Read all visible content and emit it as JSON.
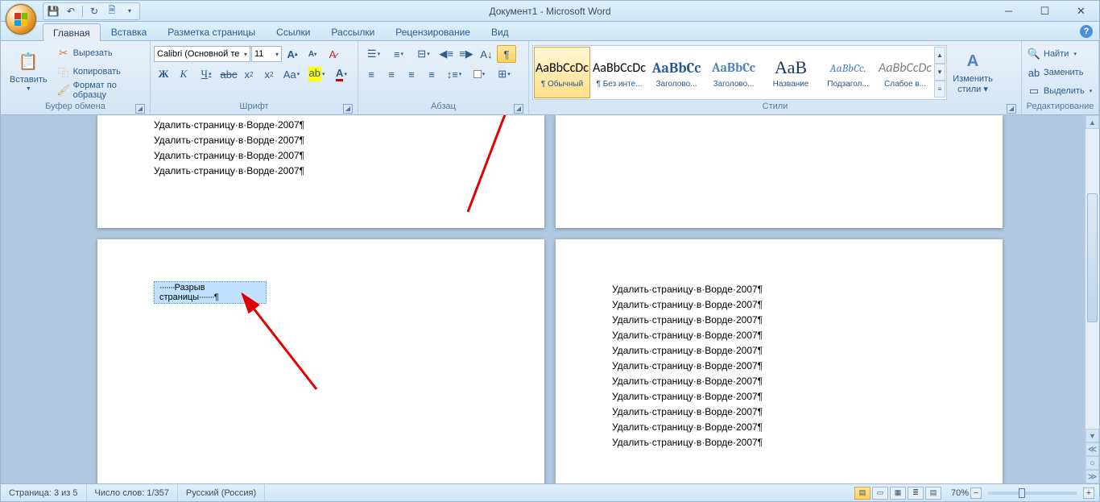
{
  "title": "Документ1 - Microsoft Word",
  "qat_tips": {
    "save": "💾",
    "undo": "↶",
    "redo": "↻",
    "print": "🖨"
  },
  "tabs": [
    "Главная",
    "Вставка",
    "Разметка страницы",
    "Ссылки",
    "Рассылки",
    "Рецензирование",
    "Вид"
  ],
  "clipboard": {
    "paste": "Вставить",
    "cut": "Вырезать",
    "copy": "Копировать",
    "format_painter": "Формат по образцу",
    "group": "Буфер обмена"
  },
  "font": {
    "name": "Calibri (Основной те",
    "size": "11",
    "group": "Шрифт"
  },
  "paragraph": {
    "group": "Абзац"
  },
  "styles": {
    "group": "Стили",
    "items": [
      {
        "preview": "AaBbCcDc",
        "label": "¶ Обычный",
        "sel": true,
        "color": "#000",
        "fam": "Calibri"
      },
      {
        "preview": "AaBbCcDc",
        "label": "¶ Без инте...",
        "color": "#000",
        "fam": "Calibri"
      },
      {
        "preview": "AaBbCc",
        "label": "Заголово...",
        "color": "#2a5a9a",
        "fam": "Cambria",
        "fs": 18,
        "fw": "bold"
      },
      {
        "preview": "AaBbCc",
        "label": "Заголово...",
        "color": "#4f81bd",
        "fam": "Cambria",
        "fs": 16,
        "fw": "bold"
      },
      {
        "preview": "АаВ",
        "label": "Название",
        "color": "#17365d",
        "fam": "Cambria",
        "fs": 22
      },
      {
        "preview": "AaBbCc.",
        "label": "Подзагол...",
        "color": "#4f81bd",
        "fam": "Cambria",
        "fs": 14,
        "fst": "italic"
      },
      {
        "preview": "AaBbCcDc",
        "label": "Слабое в...",
        "color": "#808080",
        "fam": "Calibri",
        "fst": "italic"
      }
    ],
    "change": "Изменить\nстили"
  },
  "editing": {
    "find": "Найти",
    "replace": "Заменить",
    "select": "Выделить",
    "group": "Редактирование"
  },
  "doc": {
    "line": "Удалить·страницу·в·Ворде·2007¶",
    "page_break": "Разрыв страницы"
  },
  "status": {
    "page": "Страница: 3 из 5",
    "words": "Число слов: 1/357",
    "lang": "Русский (Россия)",
    "zoom": "70%"
  }
}
